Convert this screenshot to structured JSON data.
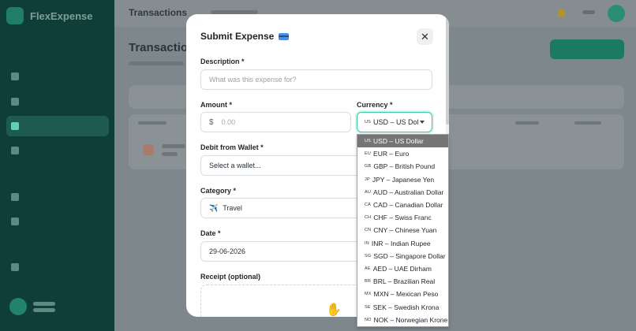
{
  "app": {
    "brand": "FlexExpense"
  },
  "topbar": {
    "title": "Transactions"
  },
  "page": {
    "title": "Transactions"
  },
  "modal": {
    "title": "Submit Expense",
    "close_symbol": "✕",
    "description": {
      "label": "Description *",
      "placeholder": "What was this expense for?"
    },
    "amount": {
      "label": "Amount *",
      "symbol": "$",
      "placeholder": "0.00"
    },
    "currency": {
      "label": "Currency *",
      "code_tag": "US",
      "value": "USD – US Dol"
    },
    "wallet": {
      "label": "Debit from Wallet *",
      "placeholder": "Select a wallet..."
    },
    "category": {
      "label": "Category *",
      "icon": "✈️",
      "value": "Travel"
    },
    "date": {
      "label": "Date *",
      "value": "29-06-2026"
    },
    "receipt": {
      "label": "Receipt (optional)"
    }
  },
  "currency_options": [
    {
      "tag": "US",
      "label": "USD – US Dollar",
      "selected": true
    },
    {
      "tag": "EU",
      "label": "EUR – Euro"
    },
    {
      "tag": "GB",
      "label": "GBP – British Pound"
    },
    {
      "tag": "JP",
      "label": "JPY – Japanese Yen"
    },
    {
      "tag": "AU",
      "label": "AUD – Australian Dollar"
    },
    {
      "tag": "CA",
      "label": "CAD – Canadian Dollar"
    },
    {
      "tag": "CH",
      "label": "CHF – Swiss Franc"
    },
    {
      "tag": "CN",
      "label": "CNY – Chinese Yuan"
    },
    {
      "tag": "IN",
      "label": "INR – Indian Rupee"
    },
    {
      "tag": "SG",
      "label": "SGD – Singapore Dollar"
    },
    {
      "tag": "AE",
      "label": "AED – UAE Dirham"
    },
    {
      "tag": "BR",
      "label": "BRL – Brazilian Real"
    },
    {
      "tag": "MX",
      "label": "MXN – Mexican Peso"
    },
    {
      "tag": "SE",
      "label": "SEK – Swedish Krona"
    },
    {
      "tag": "NO",
      "label": "NOK – Norwegian Krone"
    }
  ],
  "colors": {
    "accent": "#39c5a1",
    "sidebar": "#0f3d37",
    "selected_option": "#757575",
    "overlay": "#7e878c"
  }
}
